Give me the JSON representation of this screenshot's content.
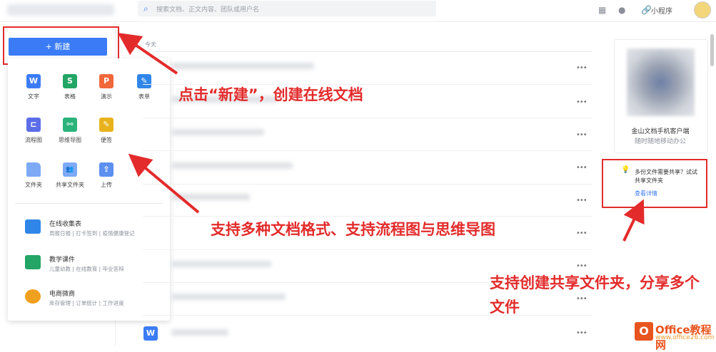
{
  "topbar": {
    "search_placeholder": "搜索文档、正文内容、团队或用户名",
    "mini_program": "小程序"
  },
  "sidebar": {
    "new_button": "+ 新建",
    "new_menu": {
      "row1": [
        {
          "label": "文字",
          "icon": "W",
          "color": "#3b7cf6"
        },
        {
          "label": "表格",
          "icon": "S",
          "color": "#22a565"
        },
        {
          "label": "演示",
          "icon": "P",
          "color": "#f2683a"
        },
        {
          "label": "表单",
          "icon": "✎",
          "color": "#2f86e8"
        }
      ],
      "row2": [
        {
          "label": "流程图",
          "icon": "⊏",
          "color": "#5b6ee8"
        },
        {
          "label": "思维导图",
          "icon": "⚯",
          "color": "#2ab37b"
        },
        {
          "label": "便签",
          "icon": "✎",
          "color": "#e8b21c"
        }
      ],
      "row3": [
        {
          "label": "文件夹",
          "icon": "",
          "color": "#7eaaf5"
        },
        {
          "label": "共享文件夹",
          "icon": "👥",
          "color": "#7eaaf5"
        },
        {
          "label": "上传",
          "icon": "⇪",
          "color": "#5b8ff0"
        }
      ],
      "templates": [
        {
          "title": "在线收集表",
          "sub": "周报日报 | 打卡签到 | 疫情健康登记",
          "color": "#2f86e8"
        },
        {
          "title": "教学课件",
          "sub": "儿童幼教 | 在线教育 | 毕业答辩",
          "color": "#22a565"
        },
        {
          "title": "电商微商",
          "sub": "库存管理 | 订单统计 | 工作进度",
          "color": "#f0a01f"
        }
      ]
    }
  },
  "main": {
    "section_today": "今天",
    "last_row_icon": "W"
  },
  "right_panel": {
    "client_title": "金山文档手机客户端",
    "client_sub": "随时随地移动办公",
    "share_tip": "多份文件需要共享？试试共享文件夹",
    "share_link": "查看详情"
  },
  "annotations": {
    "a1": "点击“新建”，创建在线文档",
    "a2": "支持多种文档格式、支持流程图与思维导图",
    "a3": "支持创建共享文件夹，分享多个文件"
  },
  "watermark": {
    "brand": "Office教程网",
    "url": "www.office26.com",
    "icon": "O"
  },
  "colors": {
    "accent": "#3b7cf6",
    "annotation": "#e32b2b"
  }
}
